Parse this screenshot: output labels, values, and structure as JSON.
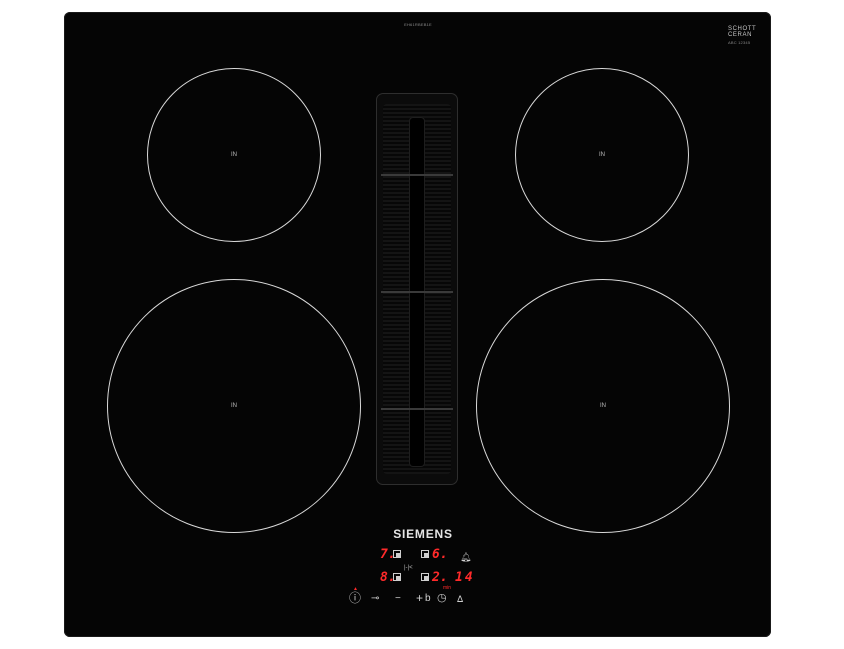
{
  "model_number": "EH61RBEB1E",
  "glass": {
    "brand_line1": "SCHOTT",
    "brand_line2": "CERAN",
    "subline": "ABC 12345"
  },
  "zones": [
    {
      "id": "back-left",
      "label": "IN"
    },
    {
      "id": "back-right",
      "label": "IN"
    },
    {
      "id": "front-left",
      "label": "IN"
    },
    {
      "id": "front-right",
      "label": "IN"
    }
  ],
  "brand": "SIEMENS",
  "display": {
    "back_left_level": "7.",
    "back_right_level": "6.",
    "front_left_level": "8.",
    "front_right_level": "2.",
    "timer_value": "14",
    "timer_unit": "min",
    "link_symbol": "|-|<",
    "bell_symbol": "🔔︎"
  },
  "controls": {
    "power": "ⓘ",
    "lock": "⊸",
    "minus": "−",
    "plus": "+",
    "boost": "b",
    "timer": "◷",
    "ventilation": "ᐃ"
  },
  "colors": {
    "glass": "#050505",
    "led": "#ff2a2a",
    "print": "#d9d9d9"
  }
}
